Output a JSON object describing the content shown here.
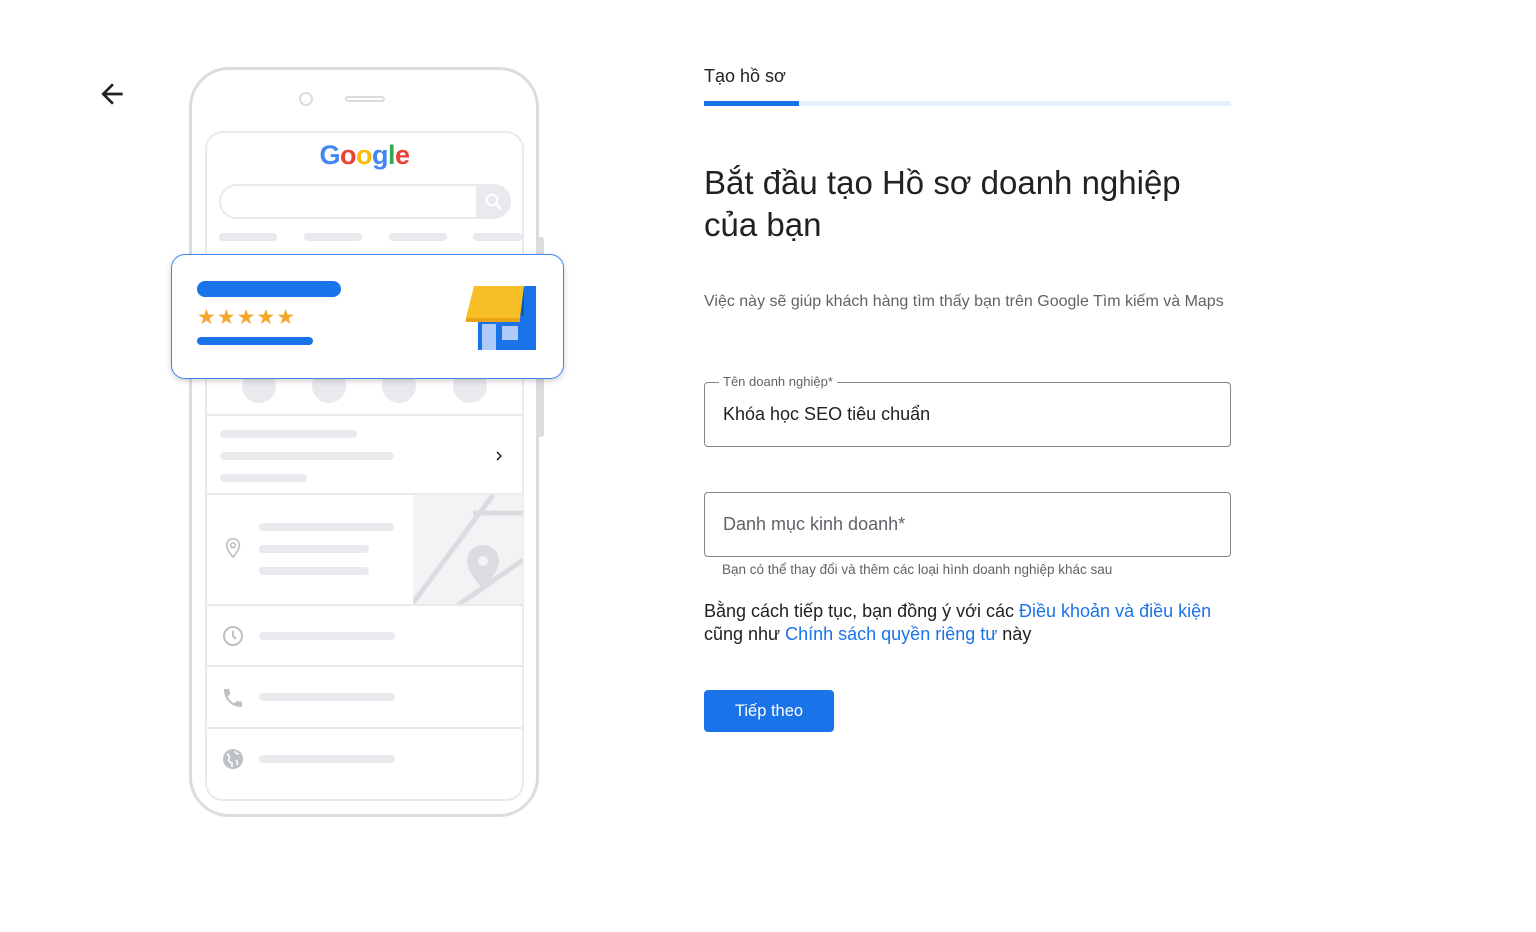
{
  "back": {
    "icon": "arrow-left-icon"
  },
  "illustration": {
    "logo_text": [
      "G",
      "o",
      "o",
      "g",
      "l",
      "e"
    ],
    "logo_colors": [
      "#4285f4",
      "#ea4335",
      "#fbbc05",
      "#4285f4",
      "#34a853",
      "#ea4335"
    ],
    "stars": "★★★★★",
    "star_color": "#f4a82a",
    "accent": "#1a73e8"
  },
  "progress": {
    "step_label": "Tạo hồ sơ",
    "value": 0.18
  },
  "heading": "Bắt đầu tạo Hồ sơ doanh nghiệp của bạn",
  "description": "Việc này sẽ giúp khách hàng tìm thấy bạn trên Google Tìm kiếm và Maps",
  "form": {
    "business_name": {
      "label": "Tên doanh nghiệp*",
      "value": "Khóa học SEO tiêu chuẩn"
    },
    "category": {
      "placeholder": "Danh mục kinh doanh*",
      "helper": "Bạn có thể thay đổi và thêm các loại hình doanh nghiệp khác sau"
    }
  },
  "terms": {
    "prefix": "Bằng cách tiếp tục, bạn đồng ý với các ",
    "terms_link": "Điều khoản và điều kiện",
    "middle": " cũng như ",
    "privacy_link": "Chính sách quyền riêng tư",
    "suffix": " này"
  },
  "next_button": "Tiếp theo"
}
